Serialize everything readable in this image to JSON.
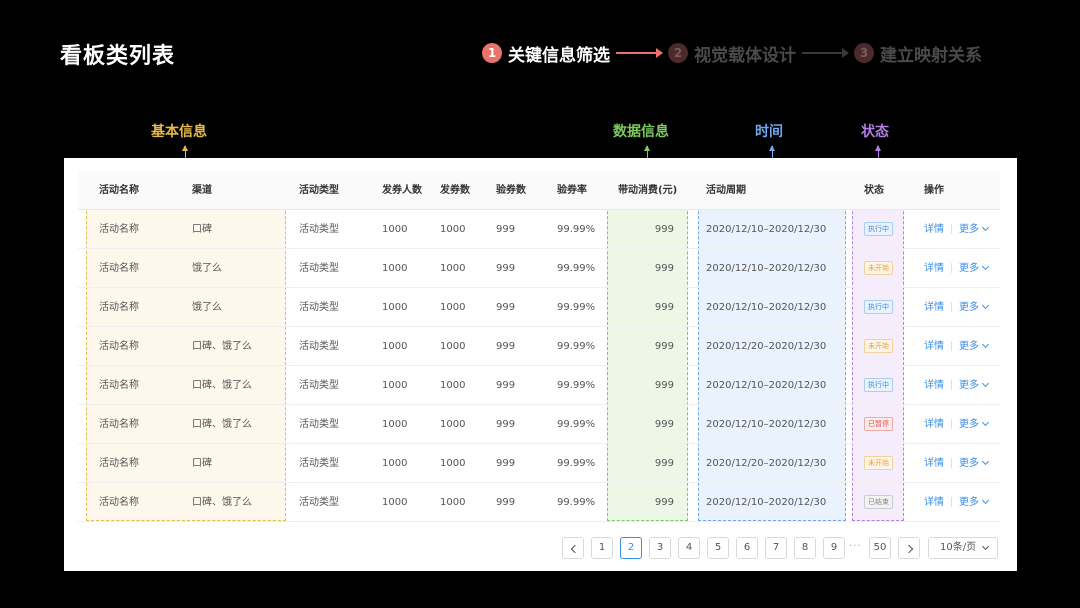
{
  "page_title": "看板类列表",
  "steps": [
    {
      "num": "1",
      "label": "关键信息筛选"
    },
    {
      "num": "2",
      "label": "视觉载体设计"
    },
    {
      "num": "3",
      "label": "建立映射关系"
    }
  ],
  "categories": {
    "basic": {
      "label": "基本信息",
      "color": "#e9b949"
    },
    "data": {
      "label": "数据信息",
      "color": "#7cc95e"
    },
    "time": {
      "label": "时间",
      "color": "#6fa8ef"
    },
    "status": {
      "label": "状态",
      "color": "#b37fe6"
    }
  },
  "table": {
    "headers": {
      "name": "活动名称",
      "channel": "渠道",
      "type": "活动类型",
      "issuers": "发券人数",
      "issued": "发券数",
      "verified": "验券数",
      "rate": "验券率",
      "spend": "带动消费(元)",
      "period": "活动周期",
      "status": "状态",
      "actions": "操作"
    },
    "rows": [
      {
        "name": "活动名称",
        "channel": "口碑",
        "type": "活动类型",
        "issuers": "1000",
        "issued": "1000",
        "verified": "999",
        "rate": "99.99%",
        "spend": "999",
        "period": "2020/12/10–2020/12/30",
        "status": "执行中",
        "status_key": "running"
      },
      {
        "name": "活动名称",
        "channel": "饿了么",
        "type": "活动类型",
        "issuers": "1000",
        "issued": "1000",
        "verified": "999",
        "rate": "99.99%",
        "spend": "999",
        "period": "2020/12/10–2020/12/30",
        "status": "未开始",
        "status_key": "pending"
      },
      {
        "name": "活动名称",
        "channel": "饿了么",
        "type": "活动类型",
        "issuers": "1000",
        "issued": "1000",
        "verified": "999",
        "rate": "99.99%",
        "spend": "999",
        "period": "2020/12/10–2020/12/30",
        "status": "执行中",
        "status_key": "running"
      },
      {
        "name": "活动名称",
        "channel": "口碑、饿了么",
        "type": "活动类型",
        "issuers": "1000",
        "issued": "1000",
        "verified": "999",
        "rate": "99.99%",
        "spend": "999",
        "period": "2020/12/20–2020/12/30",
        "status": "未开始",
        "status_key": "pending"
      },
      {
        "name": "活动名称",
        "channel": "口碑、饿了么",
        "type": "活动类型",
        "issuers": "1000",
        "issued": "1000",
        "verified": "999",
        "rate": "99.99%",
        "spend": "999",
        "period": "2020/12/10–2020/12/30",
        "status": "执行中",
        "status_key": "running"
      },
      {
        "name": "活动名称",
        "channel": "口碑、饿了么",
        "type": "活动类型",
        "issuers": "1000",
        "issued": "1000",
        "verified": "999",
        "rate": "99.99%",
        "spend": "999",
        "period": "2020/12/10–2020/12/30",
        "status": "已暂停",
        "status_key": "paused"
      },
      {
        "name": "活动名称",
        "channel": "口碑",
        "type": "活动类型",
        "issuers": "1000",
        "issued": "1000",
        "verified": "999",
        "rate": "99.99%",
        "spend": "999",
        "period": "2020/12/20–2020/12/30",
        "status": "未开始",
        "status_key": "pending"
      },
      {
        "name": "活动名称",
        "channel": "口碑、饿了么",
        "type": "活动类型",
        "issuers": "1000",
        "issued": "1000",
        "verified": "999",
        "rate": "99.99%",
        "spend": "999",
        "period": "2020/12/10–2020/12/30",
        "status": "已结束",
        "status_key": "ended"
      }
    ],
    "action_detail": "详情",
    "action_more": "更多"
  },
  "status_colors": {
    "running": {
      "fg": "#3a8ee6",
      "bg": "#eaf3fd",
      "border": "#a9cdf5"
    },
    "pending": {
      "fg": "#e8a23b",
      "bg": "#fdf5e8",
      "border": "#f3d09c"
    },
    "paused": {
      "fg": "#e04848",
      "bg": "#fdecec",
      "border": "#f2a9a9"
    },
    "ended": {
      "fg": "#888888",
      "bg": "#f2f2f2",
      "border": "#cccccc"
    }
  },
  "pagination": {
    "pages": [
      "1",
      "2",
      "3",
      "4",
      "5",
      "6",
      "7",
      "8",
      "9"
    ],
    "current": "2",
    "ellipsis": "···",
    "last": "50",
    "page_size": "10条/页"
  }
}
